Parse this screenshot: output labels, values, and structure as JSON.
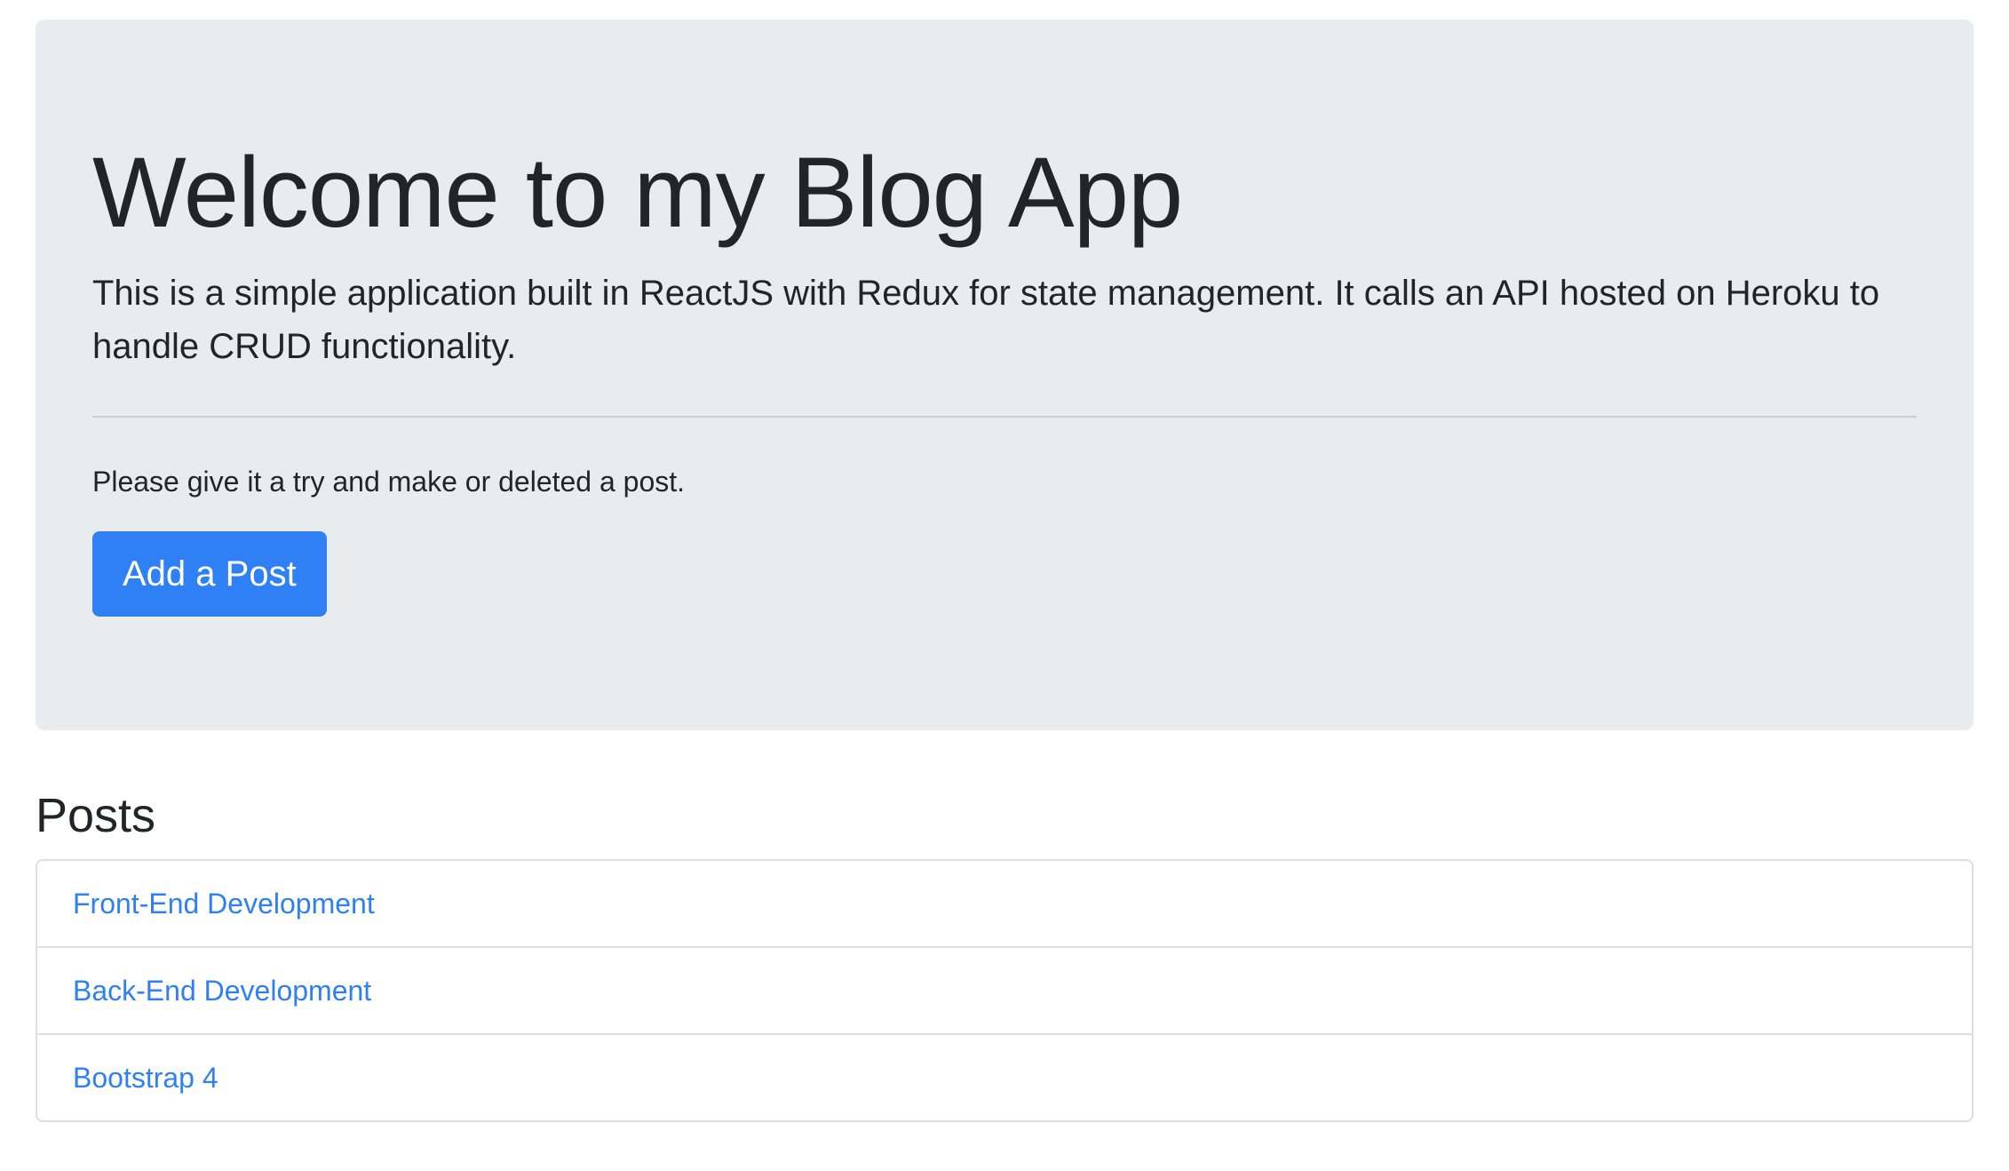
{
  "jumbotron": {
    "title": "Welcome to my Blog App",
    "lead": "This is a simple application built in ReactJS with Redux for state management. It calls an API hosted on Heroku to handle CRUD functionality.",
    "prompt": "Please give it a try and make or deleted a post.",
    "button_label": "Add a Post"
  },
  "posts": {
    "heading": "Posts",
    "items": [
      {
        "title": "Front-End Development"
      },
      {
        "title": "Back-End Development"
      },
      {
        "title": "Bootstrap 4"
      }
    ]
  },
  "colors": {
    "accent": "#2f80f5",
    "jumbotron_bg": "#e9ecef",
    "text": "#212529"
  }
}
